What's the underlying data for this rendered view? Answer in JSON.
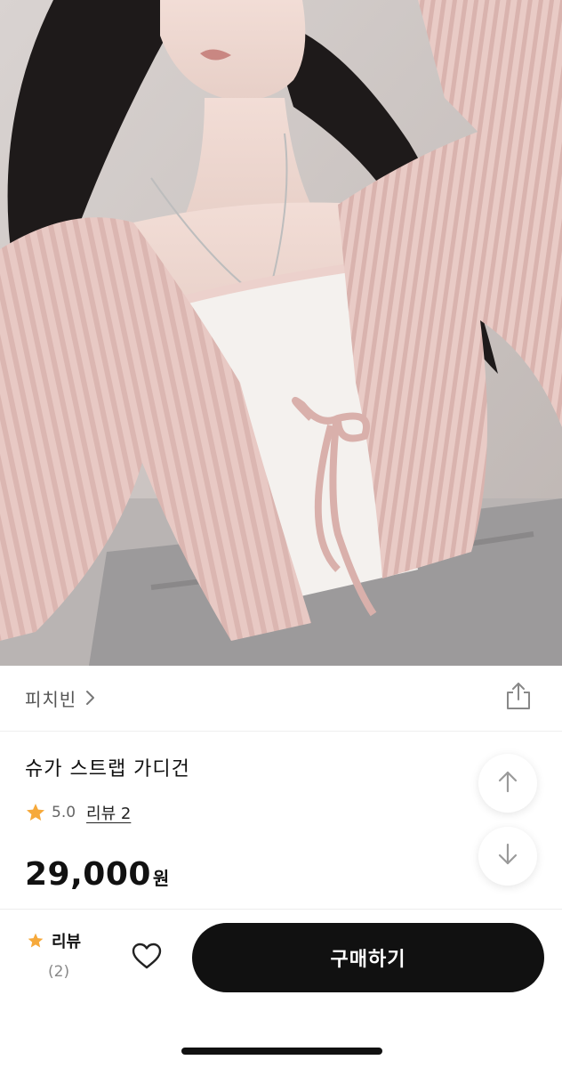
{
  "product_image": {
    "description_icon": "product-photo"
  },
  "store": {
    "name": "피치빈",
    "chevron_icon": "chevron-right-icon",
    "share_icon": "share-icon"
  },
  "product": {
    "title": "슈가 스트랩 가디건",
    "rating": "5.0",
    "review_link": "리뷰 2",
    "price": "29,000",
    "price_unit": "원"
  },
  "scroll": {
    "up_icon": "arrow-up-icon",
    "down_icon": "arrow-down-icon"
  },
  "bottom_bar": {
    "review_label": "리뷰",
    "review_count": "(2)",
    "heart_icon": "heart-icon",
    "buy_label": "구매하기"
  },
  "colors": {
    "star": "#f6a93b",
    "buy_button": "#111111",
    "fab_icon": "#9a9a9a"
  }
}
